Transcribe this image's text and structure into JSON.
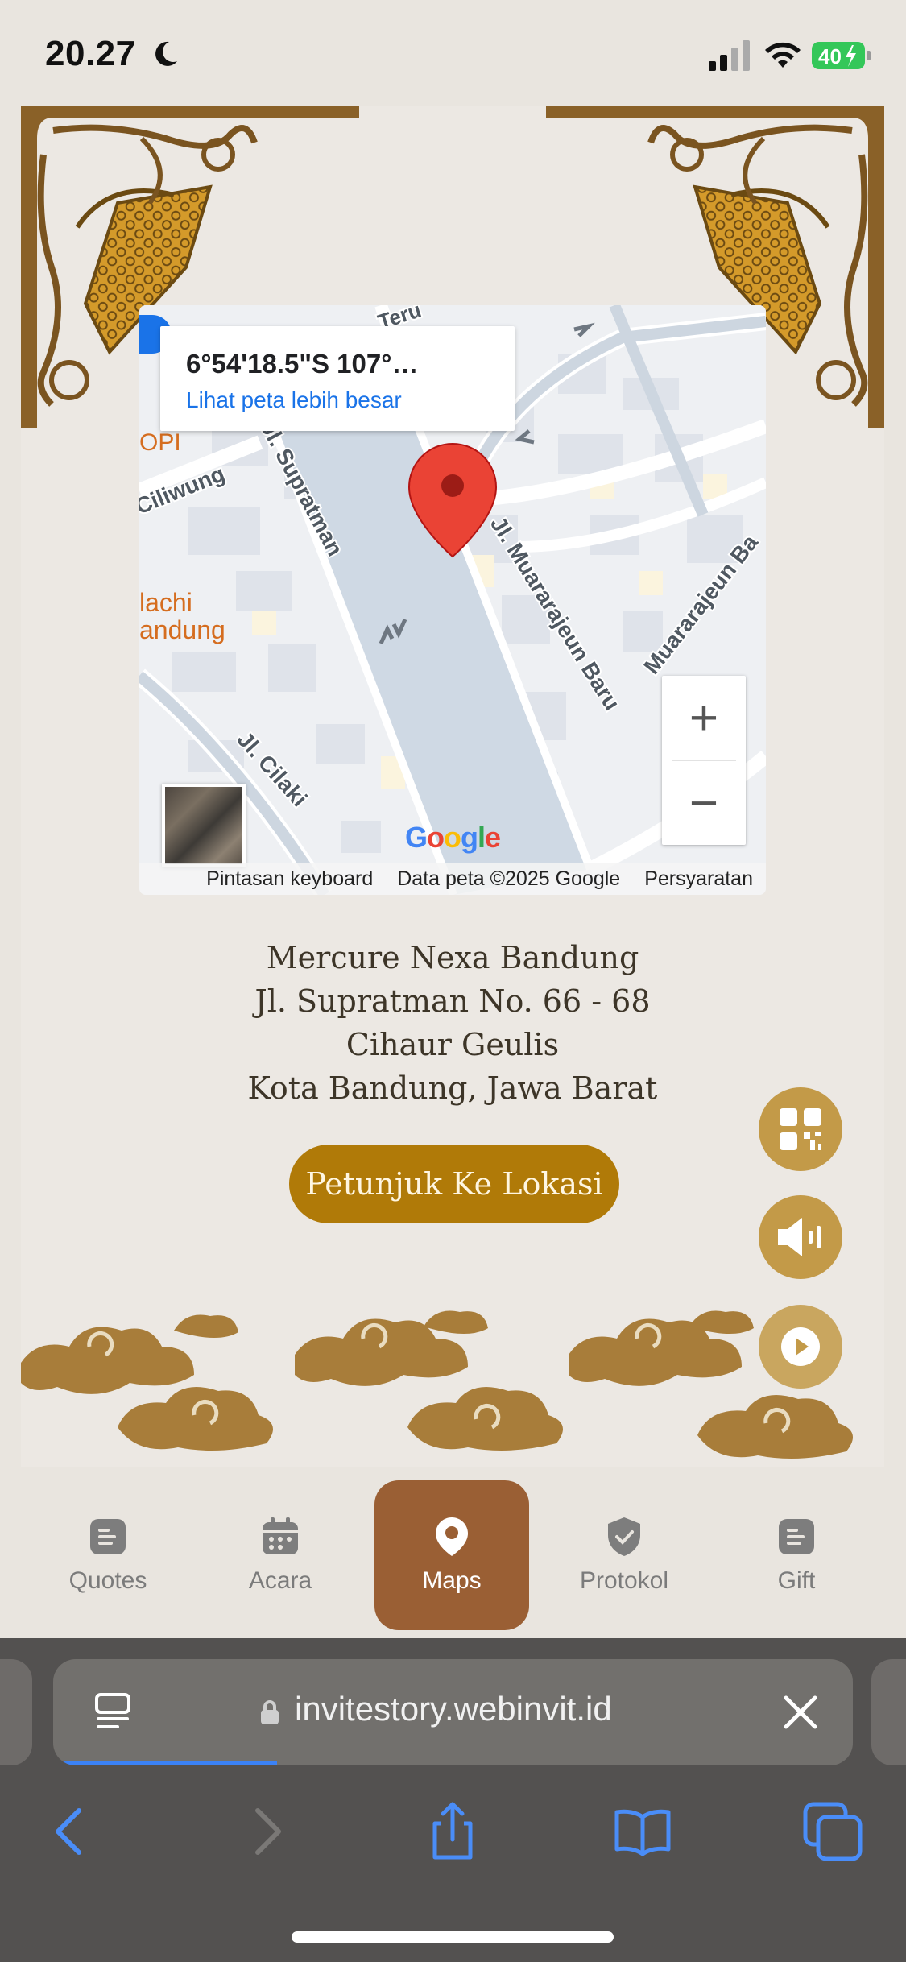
{
  "status_bar": {
    "time": "20.27",
    "battery": "40"
  },
  "map": {
    "coordinates": "6°54'18.5\"S 107°…",
    "link": "Lihat peta lebih besar",
    "zoom_in": "+",
    "zoom_out": "−",
    "streets": [
      {
        "id": "supratman",
        "text": "Jl. Supratman"
      },
      {
        "id": "muararajeun",
        "text": "Jl. Muararajeun Baru"
      },
      {
        "id": "muararajeun2",
        "text": "Muararajeun Ba"
      },
      {
        "id": "ciliwung",
        "text": "Ciliwung"
      },
      {
        "id": "cilaki",
        "text": "Jl. Cilaki"
      },
      {
        "id": "teru",
        "text": "Teru"
      }
    ],
    "poi": [
      {
        "id": "opi",
        "text": "OPI"
      },
      {
        "id": "lachi1",
        "text": "lachi"
      },
      {
        "id": "lachi2",
        "text": "andung"
      }
    ],
    "logo": "Google",
    "footer": {
      "shortcuts": "Pintasan keyboard",
      "data": "Data peta ©2025 Google",
      "terms": "Persyaratan"
    }
  },
  "address": {
    "name": "Mercure Nexa Bandung",
    "street": "Jl. Supratman No. 66 - 68",
    "area": "Cihaur Geulis",
    "city": "Kota Bandung, Jawa Barat"
  },
  "direction_button": "Petunjuk Ke Lokasi",
  "nav": [
    {
      "label": "Quotes",
      "icon": "document-icon"
    },
    {
      "label": "Acara",
      "icon": "calendar-icon"
    },
    {
      "label": "Maps",
      "icon": "map-pin-icon",
      "active": true
    },
    {
      "label": "Protokol",
      "icon": "shield-check-icon"
    },
    {
      "label": "Gift",
      "icon": "document-icon"
    }
  ],
  "browser": {
    "url": "invitestory.webinvit.id",
    "load_progress": 0.28
  },
  "colors": {
    "accent": "#b07a08",
    "nav_active": "#9a5f34",
    "gold": "#c39a48",
    "cloud": "#a87d3a"
  }
}
